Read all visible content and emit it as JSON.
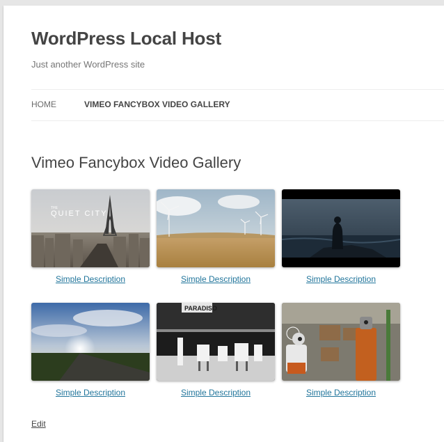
{
  "site": {
    "title": "WordPress Local Host",
    "description": "Just another WordPress site"
  },
  "nav": {
    "items": [
      {
        "label": "HOME",
        "current": false
      },
      {
        "label": "VIMEO FANCYBOX VIDEO GALLERY",
        "current": true
      }
    ]
  },
  "page": {
    "title": "Vimeo Fancybox Video Gallery",
    "edit_label": "Edit"
  },
  "gallery": {
    "items": [
      {
        "thumbnail": "quiet-city-paris-skyline",
        "overlay_text": "QUIET CITY",
        "overlay_small": "THE",
        "caption": "Simple Description"
      },
      {
        "thumbnail": "wind-turbines-field",
        "caption": "Simple Description"
      },
      {
        "thumbnail": "figure-by-dark-sea",
        "caption": "Simple Description"
      },
      {
        "thumbnail": "sunset-road-sky",
        "caption": "Simple Description"
      },
      {
        "thumbnail": "paradiso-black-white-diner",
        "overlay_text": "PARADISO",
        "caption": "Simple Description"
      },
      {
        "thumbnail": "robots-in-warehouse",
        "caption": "Simple Description"
      }
    ]
  },
  "colors": {
    "link": "#21759b",
    "title": "#444444",
    "background": "#e6e6e6"
  }
}
